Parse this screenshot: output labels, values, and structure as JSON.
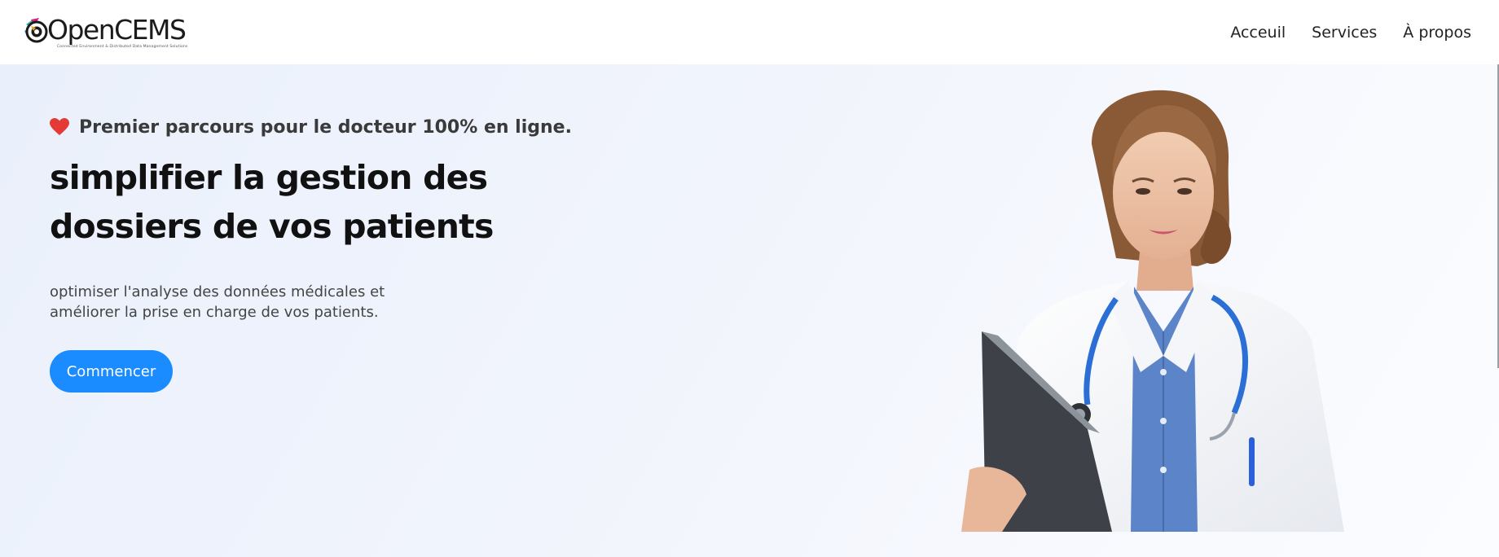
{
  "brand": {
    "name": "OpenCEMS",
    "tagline": "Connected Environment & Distributed Data Management Solutions"
  },
  "nav": {
    "items": [
      {
        "label": "Acceuil"
      },
      {
        "label": "Services"
      },
      {
        "label": "À propos"
      }
    ]
  },
  "hero": {
    "tagline_icon": "heart-icon",
    "tagline": "Premier parcours pour le docteur 100% en ligne.",
    "headline_line1": "simplifier la gestion des",
    "headline_line2": "dossiers de vos patients",
    "subtext_line1": "optimiser l'analyse des données médicales et",
    "subtext_line2": "améliorer la prise en charge de vos patients.",
    "cta_label": "Commencer"
  },
  "colors": {
    "accent": "#1a8cff",
    "heart": "#e53935",
    "hero_bg": "#eef2fc",
    "coat": "#ffffff",
    "stethoscope": "#2b6fd6",
    "shirt": "#5b84c9"
  }
}
